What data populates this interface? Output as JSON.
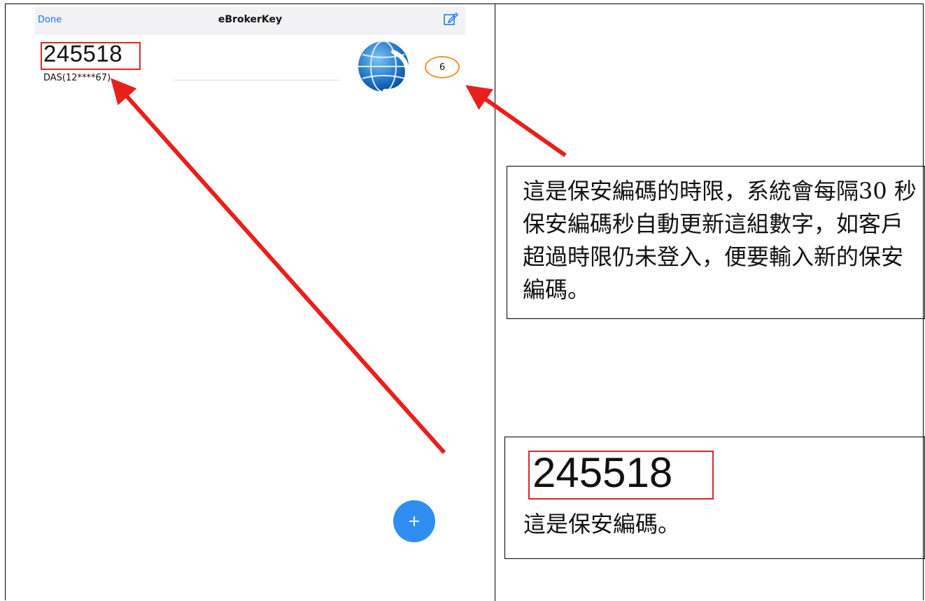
{
  "nav": {
    "done_label": "Done",
    "title": "eBrokerKey"
  },
  "token": {
    "code": "245518",
    "account": "DAS(12****67)"
  },
  "timer": {
    "seconds": "6"
  },
  "fab": {
    "label": "+"
  },
  "annotations": {
    "timer_note": "這是保安編碼的時限，系統會每隔30 秒保安編碼秒自動更新這組數字，如客戶超過時限仍未登入，便要輸入新的保安編碼。",
    "code_note_code": "245518",
    "code_note_caption": "這是保安編碼。"
  },
  "colors": {
    "arrow": "#e8201c",
    "code_box": "#d42a2a",
    "timer_ring": "#f0953d",
    "fab": "#2f8ff0",
    "link": "#1a73e8"
  },
  "icons": {
    "edit": "edit-icon",
    "globe": "globe-logo-icon",
    "add": "plus-icon"
  }
}
